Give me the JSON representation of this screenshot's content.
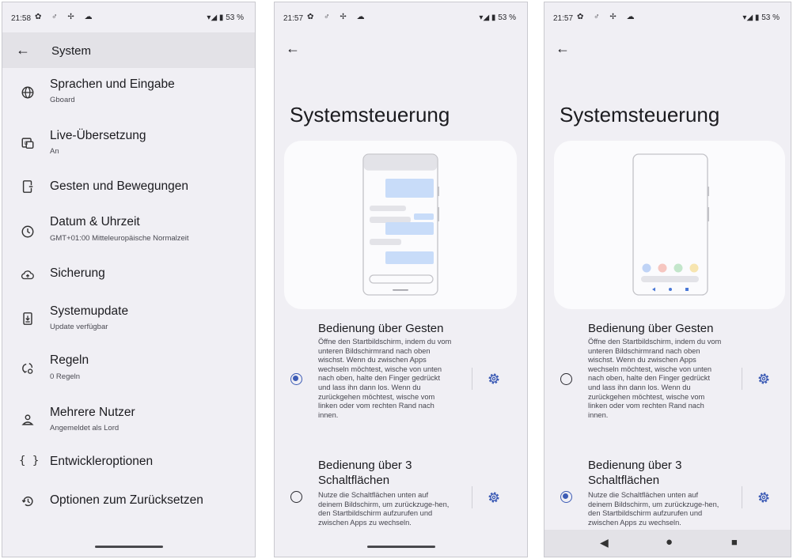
{
  "colors": {
    "background": "#f0eff4",
    "appbar": "#e3e2e7",
    "accent": "#3c5bb5",
    "text": "#1b1b1f"
  },
  "panel1": {
    "status": {
      "time": "21:58",
      "battery": "53 %"
    },
    "appbar": {
      "back_icon": "arrow-left-icon",
      "title": "System"
    },
    "items": [
      {
        "icon": "globe-icon",
        "title": "Sprachen und Eingabe",
        "subtitle": "Gboard"
      },
      {
        "icon": "translate-icon",
        "title": "Live-Übersetzung",
        "subtitle": "An"
      },
      {
        "icon": "phone-gesture-icon",
        "title": "Gesten und Bewegungen",
        "subtitle": ""
      },
      {
        "icon": "clock-icon",
        "title": "Datum & Uhrzeit",
        "subtitle": "GMT+01:00 Mitteleuropäische Normalzeit"
      },
      {
        "icon": "cloud-backup-icon",
        "title": "Sicherung",
        "subtitle": ""
      },
      {
        "icon": "system-update-icon",
        "title": "Systemupdate",
        "subtitle": "Update verfügbar"
      },
      {
        "icon": "rules-icon",
        "title": "Regeln",
        "subtitle": "0 Regeln"
      },
      {
        "icon": "person-icon",
        "title": "Mehrere Nutzer",
        "subtitle": "Angemeldet als Lord"
      },
      {
        "icon": "braces-icon",
        "title": "Entwickleroptionen",
        "subtitle": ""
      },
      {
        "icon": "history-icon",
        "title": "Optionen zum Zurücksetzen",
        "subtitle": ""
      }
    ],
    "braces_glyph": "{ }"
  },
  "panel2": {
    "status": {
      "time": "21:57",
      "battery": "53 %"
    },
    "title": "Systemsteuerung",
    "options": [
      {
        "title": "Bedienung über Gesten",
        "description": "Öffne den Startbildschirm, indem du vom unteren Bildschirmrand nach oben wischst. Wenn du zwischen Apps wechseln möchtest, wische von unten nach oben, halte den Finger gedrückt und lass ihn dann los. Wenn du zurückgehen möchtest, wische vom linken oder vom rechten Rand nach innen.",
        "selected": true
      },
      {
        "title": "Bedienung über 3 Schaltflächen",
        "description": "Nutze die Schaltflächen unten auf deinem Bildschirm, um zurückzuge-hen, den Startbildschirm aufzurufen und zwischen Apps zu wechseln.",
        "selected": false
      }
    ]
  },
  "panel3": {
    "status": {
      "time": "21:57",
      "battery": "53 %"
    },
    "title": "Systemsteuerung",
    "options": [
      {
        "title": "Bedienung über Gesten",
        "description": "Öffne den Startbildschirm, indem du vom unteren Bildschirmrand nach oben wischst. Wenn du zwischen Apps wechseln möchtest, wische von unten nach oben, halte den Finger gedrückt und lass ihn dann los. Wenn du zurückgehen möchtest, wische vom linken oder vom rechten Rand nach innen.",
        "selected": false
      },
      {
        "title": "Bedienung über 3 Schaltflächen",
        "description": "Nutze die Schaltflächen unten auf deinem Bildschirm, um zurückzuge-hen, den Startbildschirm aufzurufen und zwischen Apps zu wechseln.",
        "selected": true
      }
    ],
    "navbar": {
      "back": "◀",
      "home": "●",
      "recents": "■"
    }
  }
}
